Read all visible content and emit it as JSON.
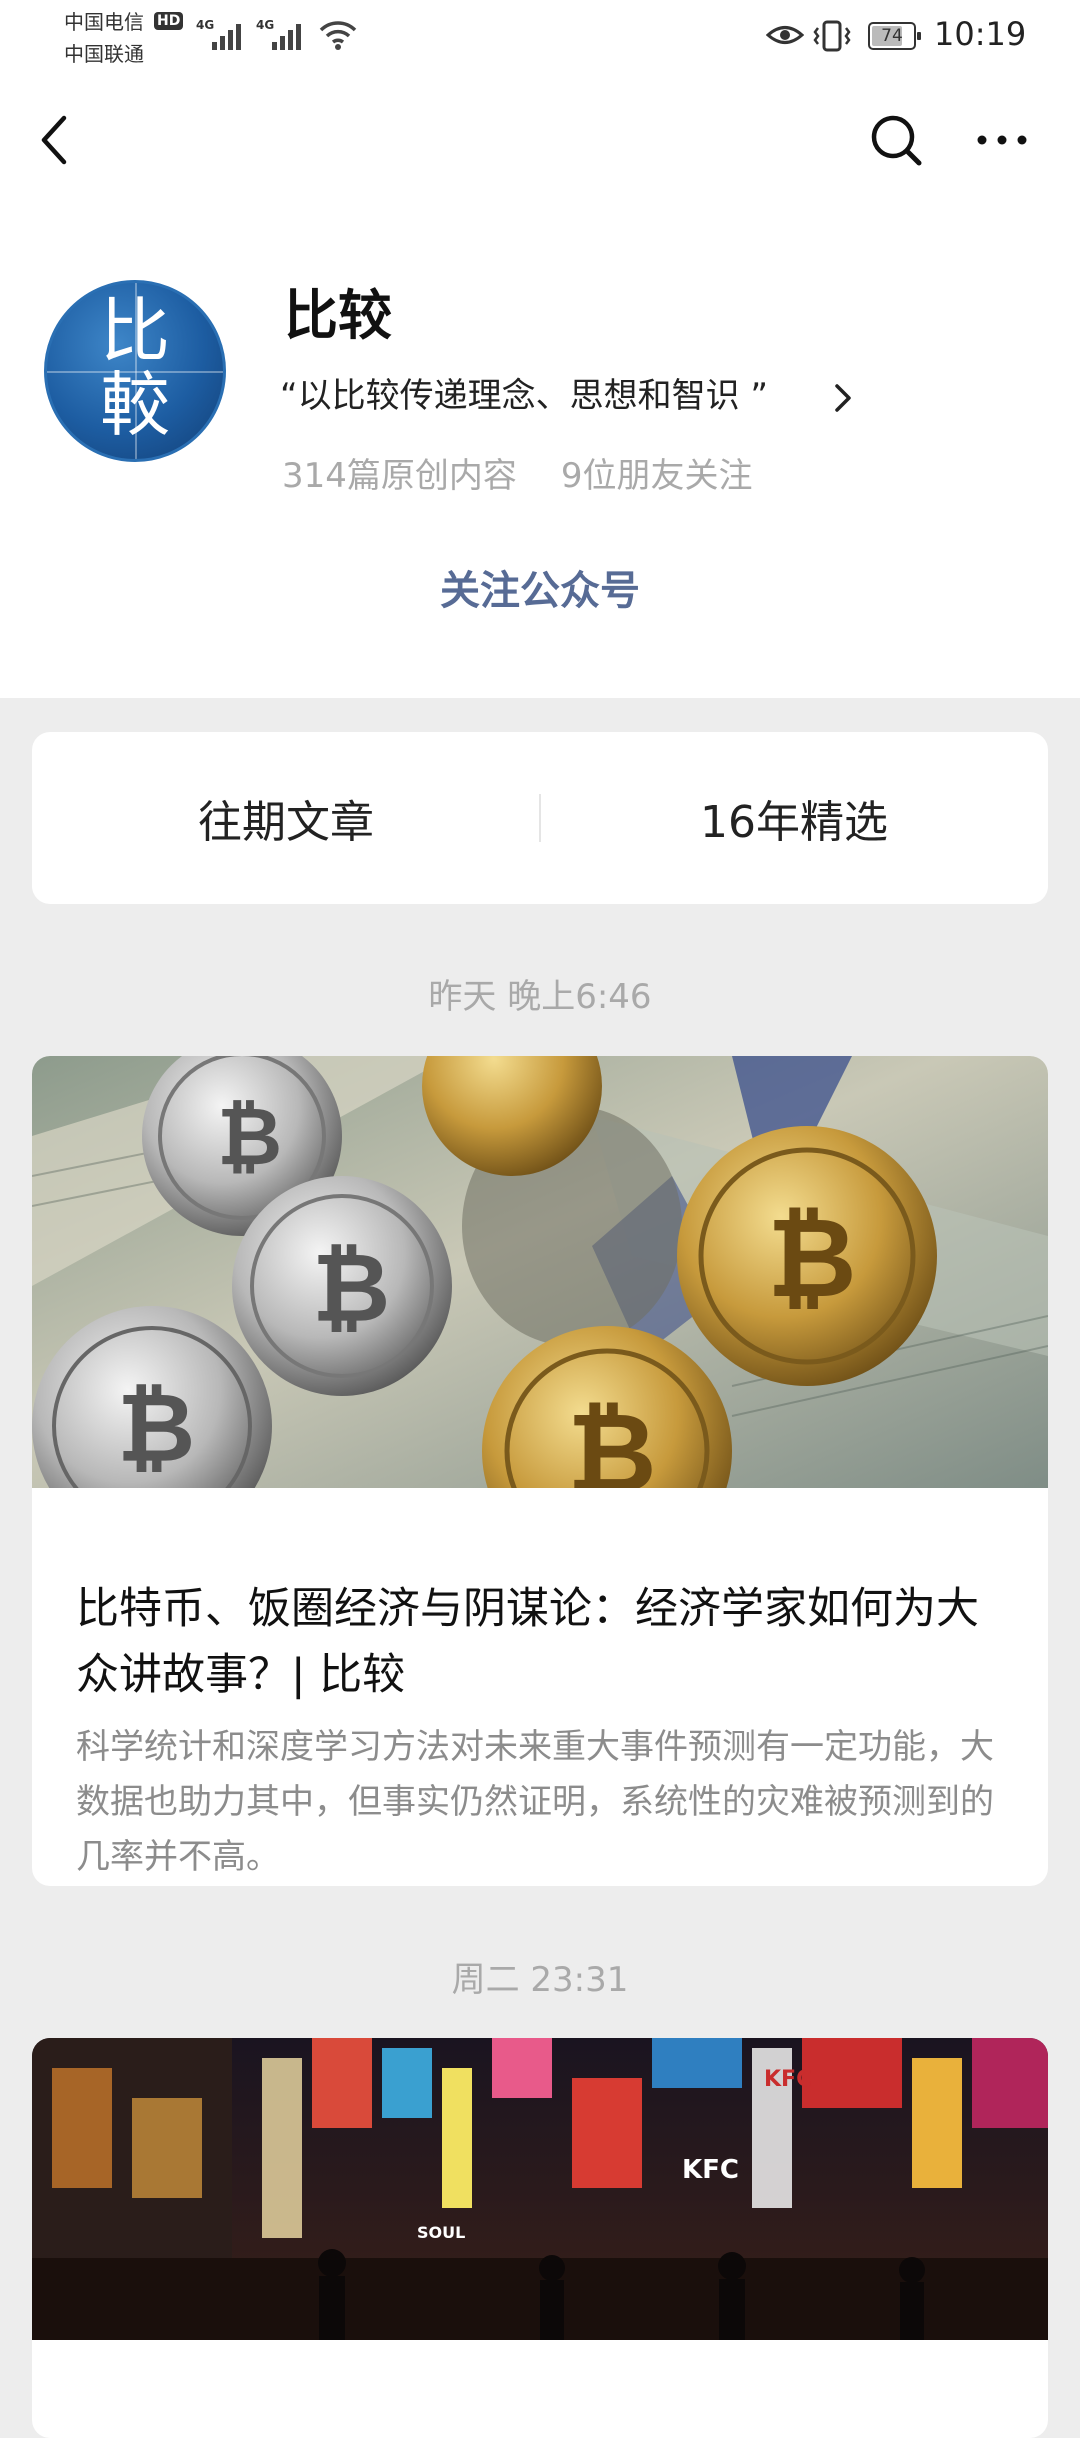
{
  "status_bar": {
    "carrier1": "中国电信",
    "hd": "HD",
    "carrier2": "中国联通",
    "signal1": "4G",
    "signal2": "4G",
    "battery": "74",
    "time": "10:19"
  },
  "nav": {
    "back": "back-arrow-icon",
    "search": "search-icon",
    "more": "more-icon"
  },
  "profile": {
    "avatar_chars": [
      "比",
      "較"
    ],
    "name": "比较",
    "description": "“以比较传递理念、思想和智识 ”",
    "original_count": "314篇原创内容",
    "friends_follow": "9位朋友关注",
    "follow_label": "关注公众号"
  },
  "tabs": [
    {
      "label": "往期文章"
    },
    {
      "label": "16年精选"
    }
  ],
  "articles": [
    {
      "date": "昨天 晚上6:46",
      "cover": "bitcoins-on-dollar-bills",
      "title": "比特币、饭圈经济与阴谋论：经济学家如何为大众讲故事？| 比较",
      "summary": "科学统计和深度学习方法对未来重大事件预测有一定功能，大数据也助力其中，但事实仍然证明，系统性的灾难被预测到的几率并不高。"
    },
    {
      "date": "周二 23:31",
      "cover": "neon-city-street-at-night",
      "signs": [
        "KFC",
        "KFC",
        "SOUL"
      ]
    }
  ],
  "colors": {
    "link_blue": "#576b95",
    "background": "#ededed",
    "muted_text": "#a9a9a9"
  }
}
